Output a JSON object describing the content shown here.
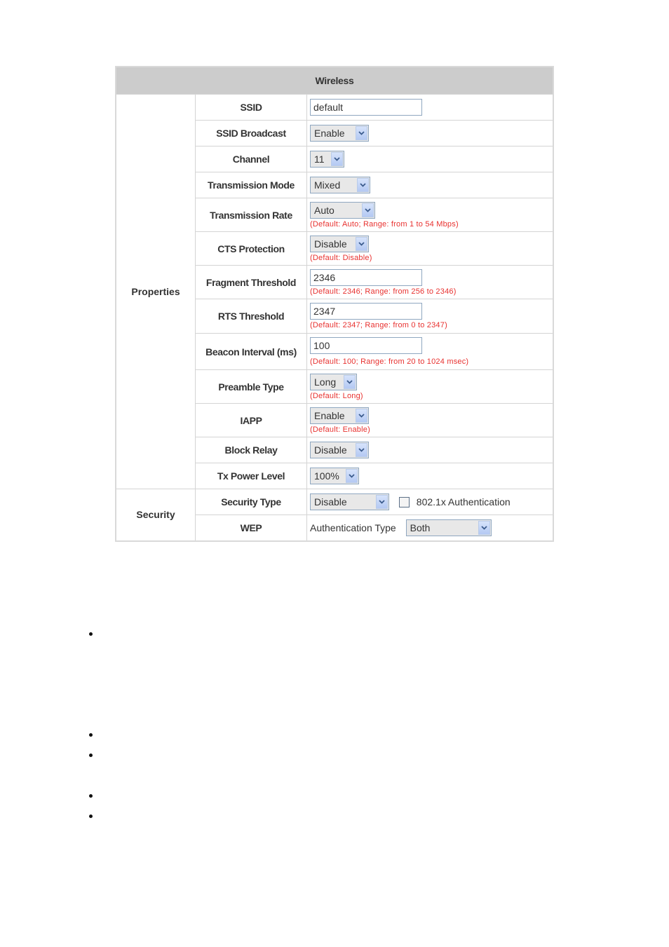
{
  "panel": {
    "title": "Wireless",
    "groups": {
      "properties": "Properties",
      "security": "Security"
    }
  },
  "rows": {
    "ssid": {
      "label": "SSID",
      "value": "default"
    },
    "ssid_broadcast": {
      "label": "SSID Broadcast",
      "value": "Enable"
    },
    "channel": {
      "label": "Channel",
      "value": "11"
    },
    "transmission_mode": {
      "label": "Transmission Mode",
      "value": "Mixed"
    },
    "transmission_rate": {
      "label": "Transmission Rate",
      "value": "Auto",
      "hint": "(Default: Auto; Range: from 1 to 54 Mbps)"
    },
    "cts_protection": {
      "label": "CTS Protection",
      "value": "Disable",
      "hint": "(Default: Disable)"
    },
    "fragment_threshold": {
      "label": "Fragment Threshold",
      "value": "2346",
      "hint": "(Default: 2346; Range: from 256 to 2346)"
    },
    "rts_threshold": {
      "label": "RTS Threshold",
      "value": "2347",
      "hint": "(Default: 2347; Range: from 0 to 2347)"
    },
    "beacon_interval": {
      "label": "Beacon Interval (ms)",
      "value": "100",
      "hint": "(Default: 100; Range: from 20 to 1024 msec)"
    },
    "preamble_type": {
      "label": "Preamble Type",
      "value": "Long",
      "hint": "(Default: Long)"
    },
    "iapp": {
      "label": "IAPP",
      "value": "Enable",
      "hint": "(Default: Enable)"
    },
    "block_relay": {
      "label": "Block Relay",
      "value": "Disable"
    },
    "tx_power_level": {
      "label": "Tx Power Level",
      "value": "100%"
    },
    "security_type": {
      "label": "Security Type",
      "value": "Disable",
      "checkbox_label": "802.1x Authentication",
      "checkbox_checked": false
    },
    "wep": {
      "label": "WEP",
      "auth_type_label": "Authentication Type",
      "auth_type_value": "Both"
    }
  },
  "colors": {
    "header_bg": "#cccccc",
    "hint_red": "#e8312f",
    "border": "#d4d4d4"
  },
  "page": {
    "bullet_count": 5
  }
}
